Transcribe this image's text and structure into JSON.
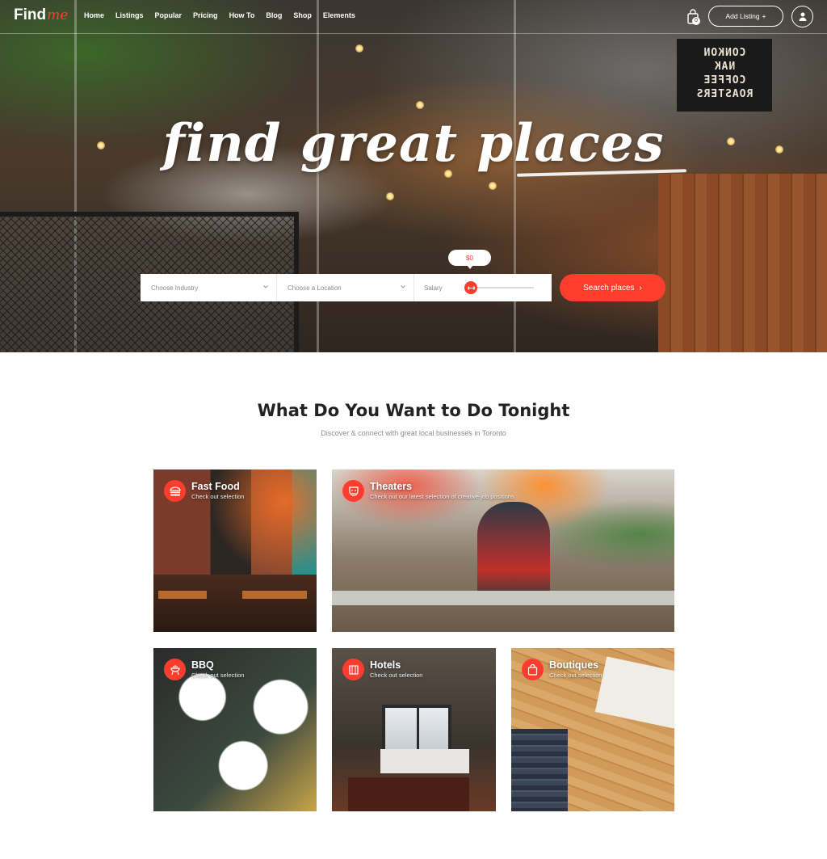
{
  "brand": {
    "name": "Find",
    "accent": "me",
    "accent_color": "#ff3d2e"
  },
  "nav": {
    "links": [
      "Home",
      "Listings",
      "Popular",
      "Pricing",
      "How To",
      "Blog",
      "Shop",
      "Elements"
    ],
    "cart_count": "0",
    "add_listing_label": "Add Listing",
    "add_listing_icon": "+",
    "user_icon": "user-icon",
    "cart_icon": "shopping-bag-icon"
  },
  "hero": {
    "title": "find great places",
    "search": {
      "industry_placeholder": "Choose Industry",
      "location_placeholder": "Choose a Location",
      "salary_label": "Salary",
      "salary_value": "$0",
      "button_label": "Search places",
      "button_icon": "›"
    }
  },
  "section": {
    "title": "What Do You Want to Do Tonight",
    "subtitle": "Discover & connect with great local businesses in Toronto"
  },
  "categories": [
    {
      "title": "Fast Food",
      "desc": "Check out selection",
      "icon": "burger-icon"
    },
    {
      "title": "Theaters",
      "desc": "Check out our latest selection of creative job positions",
      "icon": "theater-mask-icon"
    },
    {
      "title": "BBQ",
      "desc": "Check out selection",
      "icon": "grill-icon"
    },
    {
      "title": "Hotels",
      "desc": "Check out selection",
      "icon": "hotel-bed-icon"
    },
    {
      "title": "Boutiques",
      "desc": "Check out selection",
      "icon": "shopping-bag-icon"
    }
  ],
  "colors": {
    "accent": "#ff3d2e",
    "text_dark": "#222222",
    "text_muted": "#8c8c8c"
  }
}
